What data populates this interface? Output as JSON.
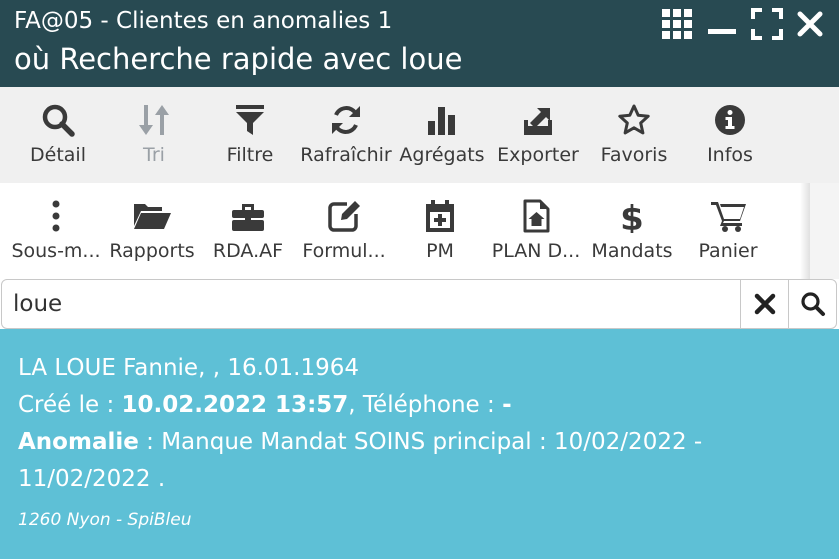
{
  "window": {
    "title_line1": "FA@05 - Clientes en anomalies 1",
    "title_line2": "où Recherche rapide avec loue",
    "controls": [
      "apps-grid-icon",
      "minimize-icon",
      "fullscreen-icon",
      "close-icon"
    ]
  },
  "toolbar1": [
    {
      "label": "Détail",
      "icon": "search-icon"
    },
    {
      "label": "Tri",
      "icon": "sort-icon",
      "disabled": true
    },
    {
      "label": "Filtre",
      "icon": "filter-icon"
    },
    {
      "label": "Rafraîchir",
      "icon": "refresh-icon"
    },
    {
      "label": "Agrégats",
      "icon": "bar-chart-icon"
    },
    {
      "label": "Exporter",
      "icon": "export-icon"
    },
    {
      "label": "Favoris",
      "icon": "star-icon"
    },
    {
      "label": "Infos",
      "icon": "info-icon"
    }
  ],
  "toolbar2": [
    {
      "label": "Sous-m...",
      "icon": "more-vertical-icon"
    },
    {
      "label": "Rapports",
      "icon": "folder-open-icon"
    },
    {
      "label": "RDA.AF",
      "icon": "briefcase-icon"
    },
    {
      "label": "Formul...",
      "icon": "edit-icon"
    },
    {
      "label": "PM",
      "icon": "calendar-plus-icon"
    },
    {
      "label": "PLAN D...",
      "icon": "document-home-icon"
    },
    {
      "label": "Mandats",
      "icon": "dollar-icon"
    },
    {
      "label": "Panier",
      "icon": "cart-icon"
    }
  ],
  "search": {
    "value": "loue",
    "clear_icon": "clear-x-icon",
    "submit_icon": "search-icon"
  },
  "result": {
    "name_line": "LA LOUE Fannie, , 16.01.1964",
    "created_label": "Créé le :",
    "created_value": "10.02.2022 13:57",
    "phone_label": ", Téléphone :",
    "phone_value": "-",
    "anomaly_label": "Anomalie",
    "anomaly_text_1": " : Manque Mandat SOINS principal : 10/02/2022 -",
    "anomaly_text_2": "11/02/2022 .",
    "municipality": "1260 Nyon - SpiBleu"
  },
  "colors": {
    "titlebar": "#284a52",
    "toolbar1_bg": "#f0f0f0",
    "result_card": "#5ec0d6",
    "icon": "#3a3a3a",
    "disabled_icon": "#9aa0a6"
  }
}
